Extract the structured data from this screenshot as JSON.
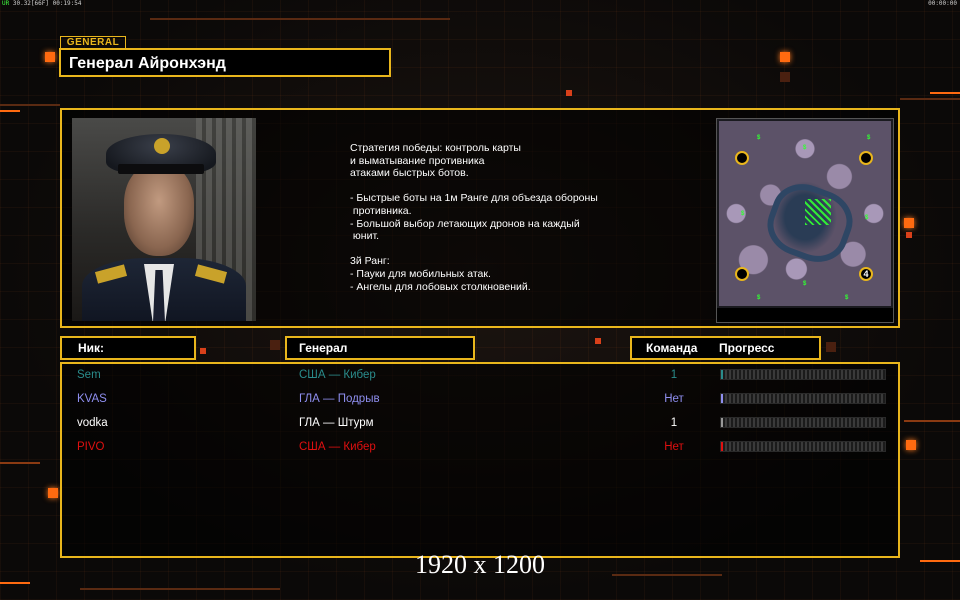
{
  "topbar": {
    "fps_label": "UR",
    "fps_value": "30.32",
    "fps_extra": "[66F]",
    "time_left": "00:19:54",
    "time_right": "00:00:00"
  },
  "header": {
    "tag": "GENERAL",
    "title": "Генерал Айронхэнд"
  },
  "info": {
    "description": "Стратегия победы: контроль карты\nи выматывание противника\nатаками быстрых ботов.\n\n- Быстрые боты на 1м Ранге для объезда обороны\n противника.\n- Большой выбор летающих дронов на каждый\n юнит.\n\n3й Ранг:\n- Пауки для мобильных атак.\n- Ангелы для лобовых столкновений.",
    "minimap": {
      "cash_marker": "$",
      "base_label": "4"
    }
  },
  "table": {
    "col_nick": "Ник:",
    "col_general": "Генерал",
    "col_team": "Команда",
    "col_progress": "Прогресс",
    "rows": [
      {
        "nick": "Sem",
        "general": "США — Кибер",
        "team": "1",
        "color": "#2a8c8c",
        "progress": 0.01
      },
      {
        "nick": "KVAS",
        "general": "ГЛА — Подрыв",
        "team": "Нет",
        "color": "#8f8ff0",
        "progress": 0.01
      },
      {
        "nick": "vodka",
        "general": "ГЛА — Штурм",
        "team": "1",
        "color": "#ffffff",
        "progress": 0.01
      },
      {
        "nick": "PIVO",
        "general": "США — Кибер",
        "team": "Нет",
        "color": "#e01010",
        "progress": 0.01
      }
    ]
  },
  "watermark": "1920 x 1200",
  "colors": {
    "frame": "#e9b61c",
    "accent": "#ff6a10"
  }
}
